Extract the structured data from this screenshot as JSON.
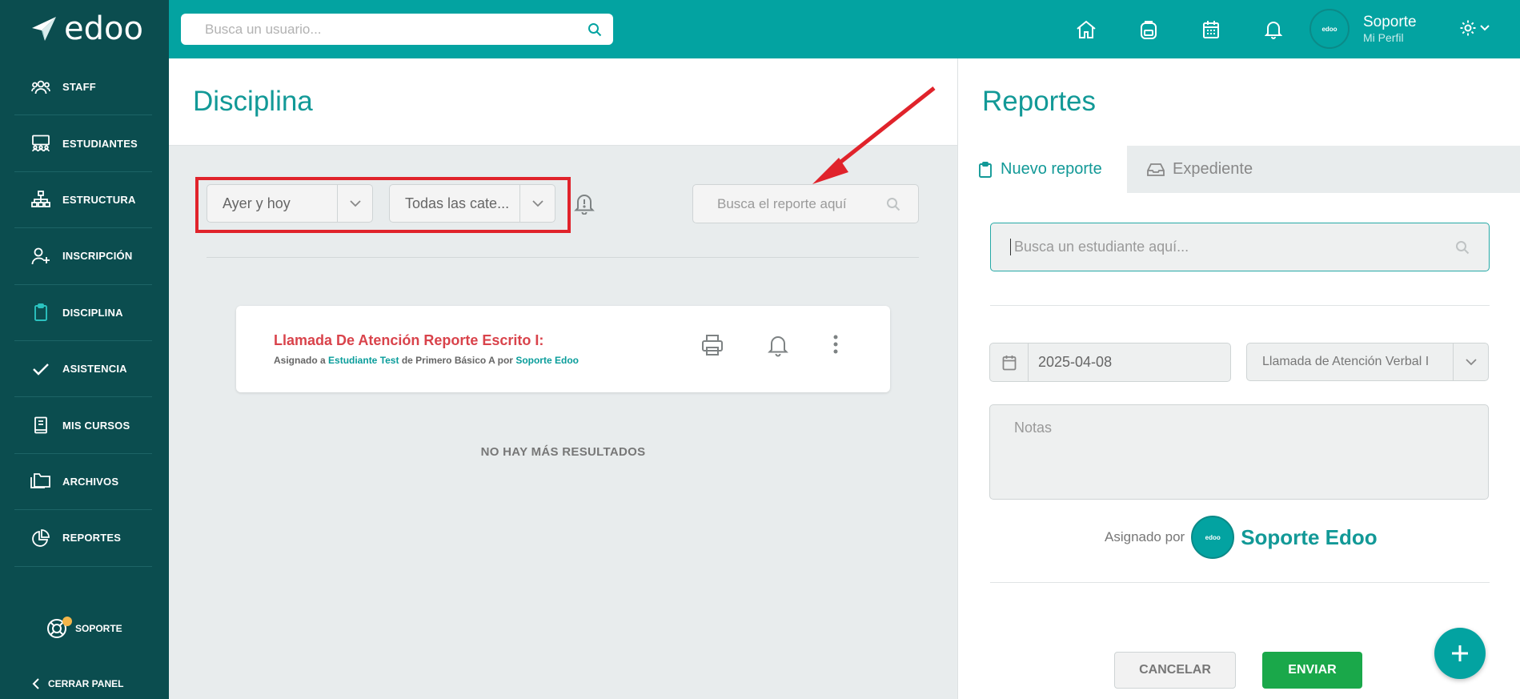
{
  "brand": {
    "name": "edoo"
  },
  "sidebar": {
    "items": [
      {
        "label": "STAFF",
        "icon": "users-icon"
      },
      {
        "label": "ESTUDIANTES",
        "icon": "classroom-icon"
      },
      {
        "label": "ESTRUCTURA",
        "icon": "hierarchy-icon"
      },
      {
        "label": "INSCRIPCIÓN",
        "icon": "user-plus-icon"
      },
      {
        "label": "DISCIPLINA",
        "icon": "clipboard-icon"
      },
      {
        "label": "ASISTENCIA",
        "icon": "check-icon"
      },
      {
        "label": "MIS CURSOS",
        "icon": "book-icon"
      },
      {
        "label": "ARCHIVOS",
        "icon": "folders-icon"
      },
      {
        "label": "REPORTES",
        "icon": "pie-chart-icon"
      }
    ],
    "support_label": "SOPORTE",
    "close_label": "CERRAR PANEL"
  },
  "topbar": {
    "search_placeholder": "Busca un usuario...",
    "user_name": "Soporte",
    "user_sub": "Mi Perfil",
    "avatar_text": "edoo"
  },
  "disciplina": {
    "title": "Disciplina",
    "filter_time": "Ayer y hoy",
    "filter_category": "Todas las cate...",
    "search_placeholder": "Busca el reporte aquí",
    "report": {
      "title": "Llamada De Atención Reporte Escrito I:",
      "pre": "Asignado a ",
      "student": "Estudiante Test",
      "mid": " de Primero Básico A por ",
      "author": "Soporte Edoo"
    },
    "no_more": "NO HAY MÁS RESULTADOS"
  },
  "reportes": {
    "title": "Reportes",
    "tab_new": "Nuevo reporte",
    "tab_file": "Expediente",
    "student_placeholder": "Busca un estudiante aquí...",
    "date": "2025-04-08",
    "type": "Llamada de Atención Verbal I",
    "notes_placeholder": "Notas",
    "assigned_pre": "Asignado por",
    "assigned_name": "Soporte Edoo",
    "avatar_text": "edoo",
    "cancel": "CANCELAR",
    "send": "ENVIAR"
  },
  "colors": {
    "sidebar": "#0b4d4f",
    "topbar": "#03a3a1",
    "accent": "#129997",
    "alert_red": "#d9434b",
    "send_green": "#1aa84a",
    "highlight_red": "#e0232b"
  }
}
